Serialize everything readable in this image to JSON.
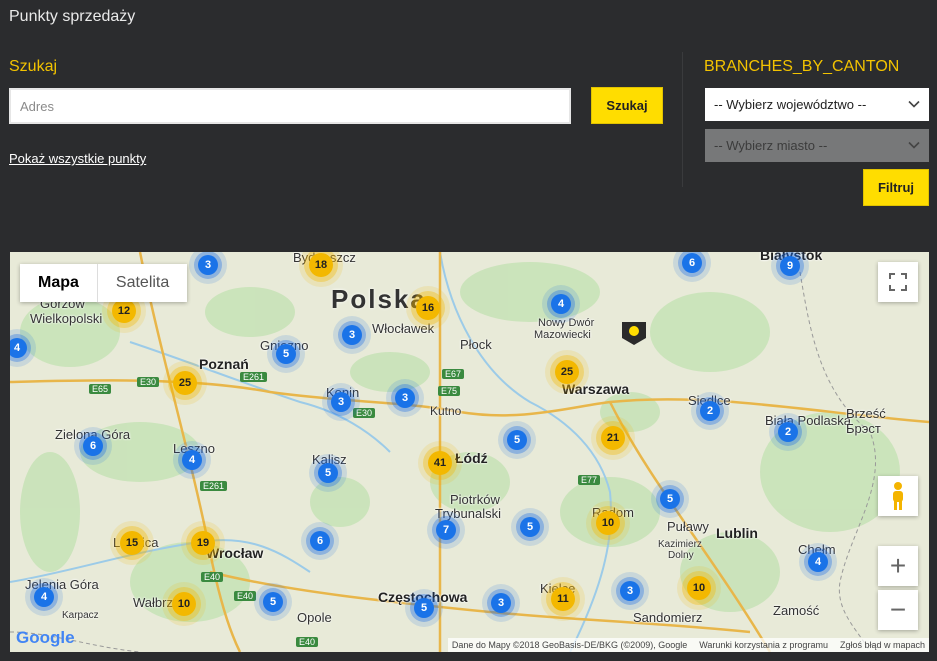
{
  "page": {
    "title": "Punkty sprzedaży"
  },
  "search": {
    "label": "Szukaj",
    "placeholder": "Adres",
    "button": "Szukaj",
    "show_all": "Pokaż wszystkie punkty"
  },
  "branches": {
    "label": "BRANCHES_BY_CANTON",
    "voivodeship": "-- Wybierz województwo --",
    "city": "-- Wybierz miasto --",
    "filter": "Filtruj"
  },
  "map": {
    "type_map": "Mapa",
    "type_satellite": "Satelita",
    "country": "Polska",
    "attribution": "Dane do Mapy ©2018 GeoBasis-DE/BKG (©2009), Google",
    "terms": "Warunki korzystania z programu",
    "report": "Zgłoś błąd w mapach",
    "logo": "Google",
    "zoom_in": "+",
    "zoom_out": "−",
    "cities": [
      {
        "id": "bydgoszcz",
        "name": "Bydgoszcz"
      },
      {
        "id": "gorzow",
        "name": "Gorzów"
      },
      {
        "id": "wielkopolski",
        "name": "Wielkopolski"
      },
      {
        "id": "poznan",
        "name": "Poznań"
      },
      {
        "id": "gniezno",
        "name": "Gniezno"
      },
      {
        "id": "wloclawek",
        "name": "Włocławek"
      },
      {
        "id": "plock",
        "name": "Płock"
      },
      {
        "id": "nowy-dwor",
        "name": "Nowy Dwór"
      },
      {
        "id": "mazowiecki",
        "name": "Mazowiecki"
      },
      {
        "id": "warszawa",
        "name": "Warszawa"
      },
      {
        "id": "bialystok",
        "name": "Białystok"
      },
      {
        "id": "siedlce",
        "name": "Siedlce"
      },
      {
        "id": "biala-podlaska",
        "name": "Biała Podlaska"
      },
      {
        "id": "brzesc",
        "name": "Brześć"
      },
      {
        "id": "brest",
        "name": "Брэст"
      },
      {
        "id": "konin",
        "name": "Konin"
      },
      {
        "id": "kutno",
        "name": "Kutno"
      },
      {
        "id": "zielona-gora",
        "name": "Zielona Góra"
      },
      {
        "id": "leszno",
        "name": "Leszno"
      },
      {
        "id": "kalisz",
        "name": "Kalisz"
      },
      {
        "id": "lodz",
        "name": "Łódź"
      },
      {
        "id": "piotrkow",
        "name": "Piotrków"
      },
      {
        "id": "trybunalski",
        "name": "Trybunalski"
      },
      {
        "id": "radom",
        "name": "Radom"
      },
      {
        "id": "pulawy",
        "name": "Puławy"
      },
      {
        "id": "lublin",
        "name": "Lublin"
      },
      {
        "id": "kazimierz",
        "name": "Kazimierz"
      },
      {
        "id": "dolny",
        "name": "Dolny"
      },
      {
        "id": "chelm",
        "name": "Chełm"
      },
      {
        "id": "legnica",
        "name": "Legnica"
      },
      {
        "id": "wroclaw",
        "name": "Wrocław"
      },
      {
        "id": "jelenia-gora",
        "name": "Jelenia Góra"
      },
      {
        "id": "walbrzych",
        "name": "Wałbrzych"
      },
      {
        "id": "karpacz",
        "name": "Karpacz"
      },
      {
        "id": "opole",
        "name": "Opole"
      },
      {
        "id": "czestochowa",
        "name": "Częstochowa"
      },
      {
        "id": "kielce",
        "name": "Kielce"
      },
      {
        "id": "sandomierz",
        "name": "Sandomierz"
      },
      {
        "id": "zamosc",
        "name": "Zamość"
      }
    ],
    "roads": [
      "E65",
      "E30",
      "E261",
      "E75",
      "E30",
      "E67",
      "E261",
      "E77",
      "E40",
      "E40",
      "E40"
    ],
    "clusters": [
      {
        "count": "3",
        "color": "blue"
      },
      {
        "count": "18",
        "color": "yellow"
      },
      {
        "count": "6",
        "color": "blue"
      },
      {
        "count": "9",
        "color": "blue"
      },
      {
        "count": "12",
        "color": "yellow"
      },
      {
        "count": "16",
        "color": "yellow"
      },
      {
        "count": "4",
        "color": "blue"
      },
      {
        "count": "4",
        "color": "blue"
      },
      {
        "count": "5",
        "color": "blue"
      },
      {
        "count": "3",
        "color": "blue"
      },
      {
        "count": "25",
        "color": "yellow"
      },
      {
        "count": "25",
        "color": "yellow"
      },
      {
        "count": "3",
        "color": "blue"
      },
      {
        "count": "3",
        "color": "blue"
      },
      {
        "count": "2",
        "color": "blue"
      },
      {
        "count": "2",
        "color": "blue"
      },
      {
        "count": "6",
        "color": "blue"
      },
      {
        "count": "4",
        "color": "blue"
      },
      {
        "count": "5",
        "color": "blue"
      },
      {
        "count": "21",
        "color": "yellow"
      },
      {
        "count": "41",
        "color": "yellow"
      },
      {
        "count": "5",
        "color": "blue"
      },
      {
        "count": "5",
        "color": "blue"
      },
      {
        "count": "7",
        "color": "blue"
      },
      {
        "count": "5",
        "color": "blue"
      },
      {
        "count": "10",
        "color": "yellow"
      },
      {
        "count": "15",
        "color": "yellow"
      },
      {
        "count": "19",
        "color": "yellow"
      },
      {
        "count": "6",
        "color": "blue"
      },
      {
        "count": "4",
        "color": "blue"
      },
      {
        "count": "4",
        "color": "blue"
      },
      {
        "count": "10",
        "color": "yellow"
      },
      {
        "count": "5",
        "color": "blue"
      },
      {
        "count": "5",
        "color": "blue"
      },
      {
        "count": "3",
        "color": "blue"
      },
      {
        "count": "11",
        "color": "yellow"
      },
      {
        "count": "3",
        "color": "blue"
      },
      {
        "count": "10",
        "color": "yellow"
      }
    ]
  }
}
